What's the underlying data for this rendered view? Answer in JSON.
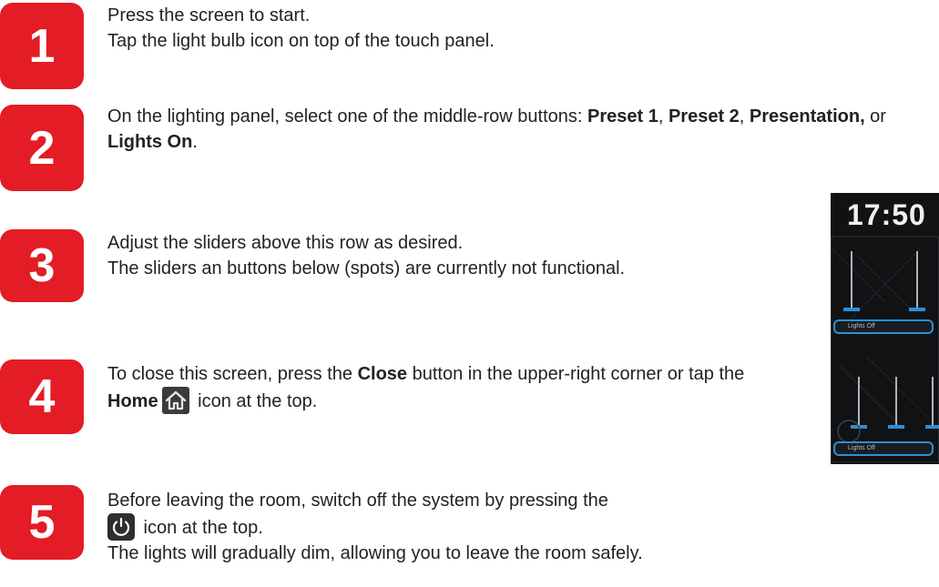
{
  "steps": [
    {
      "number": "1",
      "lines": [
        "Press the screen to start.",
        "Tap the light bulb icon on top of the touch panel."
      ]
    },
    {
      "number": "2",
      "p1": "On the lighting panel, select one of the middle-row buttons: ",
      "b1": "Preset 1",
      "p2": ", ",
      "b2": "Preset 2",
      "p3": ", ",
      "b3": "Presentation,",
      "p4": " or ",
      "b4": "Lights On",
      "p5": "."
    },
    {
      "number": "3",
      "lines": [
        "Adjust the sliders above this row as desired.",
        "The sliders an buttons below (spots) are currently not functional."
      ]
    },
    {
      "number": "4",
      "p1": "To close this screen, press the ",
      "b1": "Close",
      "p2": " button in the upper-right corner or tap the ",
      "b2": "Home",
      "p3": " icon at the top."
    },
    {
      "number": "5",
      "p1": "Before leaving the room, switch off the system by pressing the",
      "p2": " icon at the top.",
      "p3": "The lights will gradually dim, allowing you to leave the room safely."
    }
  ],
  "panel": {
    "clock": "17:50",
    "lights_off_top": "Lights Off",
    "lights_off_bottom": "Lights Off"
  },
  "icons": {
    "home": "home-icon",
    "power": "power-icon"
  },
  "colors": {
    "badge": "#e31c25",
    "panel_accent": "#2d8fd6",
    "panel_bg": "#111214"
  }
}
